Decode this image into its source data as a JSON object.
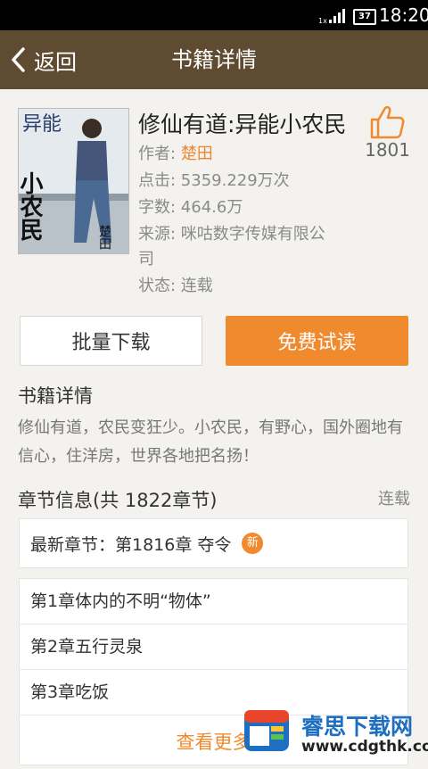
{
  "status_bar": {
    "network": "1x",
    "battery": "37",
    "time": "18:20"
  },
  "header": {
    "back_label": "返回",
    "title": "书籍详情"
  },
  "book": {
    "title": "修仙有道:异能小农民",
    "likes": "1801",
    "author_label": "作者:",
    "author": "楚田",
    "clicks": "点击: 5359.229万次",
    "words": "字数: 464.6万",
    "source": "来源: 咪咕数字传媒有限公",
    "source_wrap": "司",
    "status": "状态: 连载",
    "cover_text": {
      "top": "异能",
      "middle": "小农民",
      "author": "楚田"
    }
  },
  "actions": {
    "batch_download": "批量下载",
    "free_read": "免费试读"
  },
  "details": {
    "heading": "书籍详情",
    "description": "修仙有道，农民变狂少。小农民，有野心，国外圈地有信心，住洋房，世界各地把名扬！"
  },
  "chapters": {
    "heading": "章节信息(共 1822章节)",
    "serial_status": "连载",
    "latest": "最新章节：第1816章 夺令",
    "new_badge": "新",
    "items": [
      {
        "label": "第1章体内的不明“物体”"
      },
      {
        "label": "第2章五行灵泉"
      },
      {
        "label": "第3章吃饭"
      }
    ],
    "more": "查看更多"
  },
  "watermark": {
    "name": "睿思下载网",
    "url": "www.cdgthk.com"
  },
  "colors": {
    "header_bg": "#5f4b31",
    "accent": "#f08a2e",
    "watermark_blue": "#1f6fc1"
  }
}
